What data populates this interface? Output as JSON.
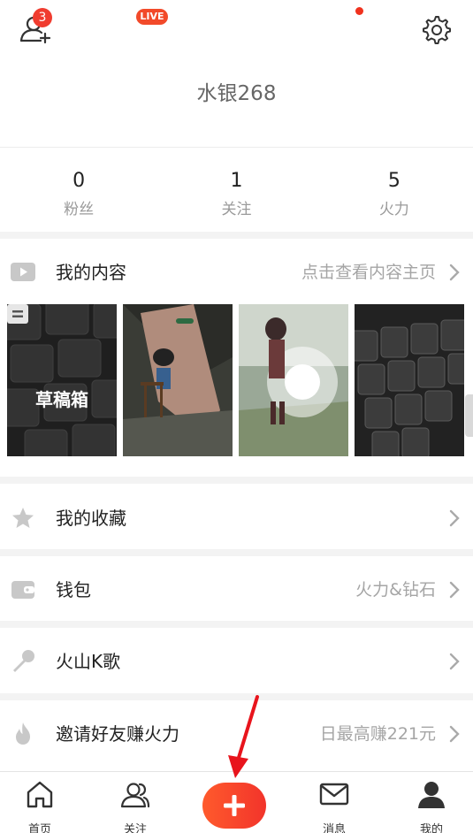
{
  "header": {
    "notification_count": "3",
    "username": "水银268"
  },
  "stats": [
    {
      "value": "0",
      "label": "粉丝"
    },
    {
      "value": "1",
      "label": "关注"
    },
    {
      "value": "5",
      "label": "火力"
    }
  ],
  "content_section": {
    "title": "我的内容",
    "hint": "点击查看内容主页",
    "draft_label": "草稿箱"
  },
  "menu": {
    "favorites": {
      "title": "我的收藏",
      "hint": ""
    },
    "wallet": {
      "title": "钱包",
      "hint": "火力&钻石"
    },
    "karaoke": {
      "title": "火山K歌",
      "hint": ""
    },
    "invite": {
      "title": "邀请好友赚火力",
      "hint": "日最高赚221元"
    }
  },
  "tabbar": {
    "home": "首页",
    "following": "关注",
    "live_badge": "LIVE",
    "messages": "消息",
    "me": "我的"
  },
  "colors": {
    "accent": "#f03c2f",
    "icon_gray": "#c8c8c8",
    "annotation_arrow": "#e8141c"
  },
  "icons": {
    "add_friend": "add-friend-icon",
    "settings": "gear-icon",
    "content": "play-icon",
    "favorites": "star-icon",
    "wallet": "wallet-icon",
    "karaoke": "microphone-icon",
    "invite": "flame-icon",
    "home": "home-icon",
    "following": "people-icon",
    "messages": "envelope-icon",
    "me": "person-icon"
  }
}
